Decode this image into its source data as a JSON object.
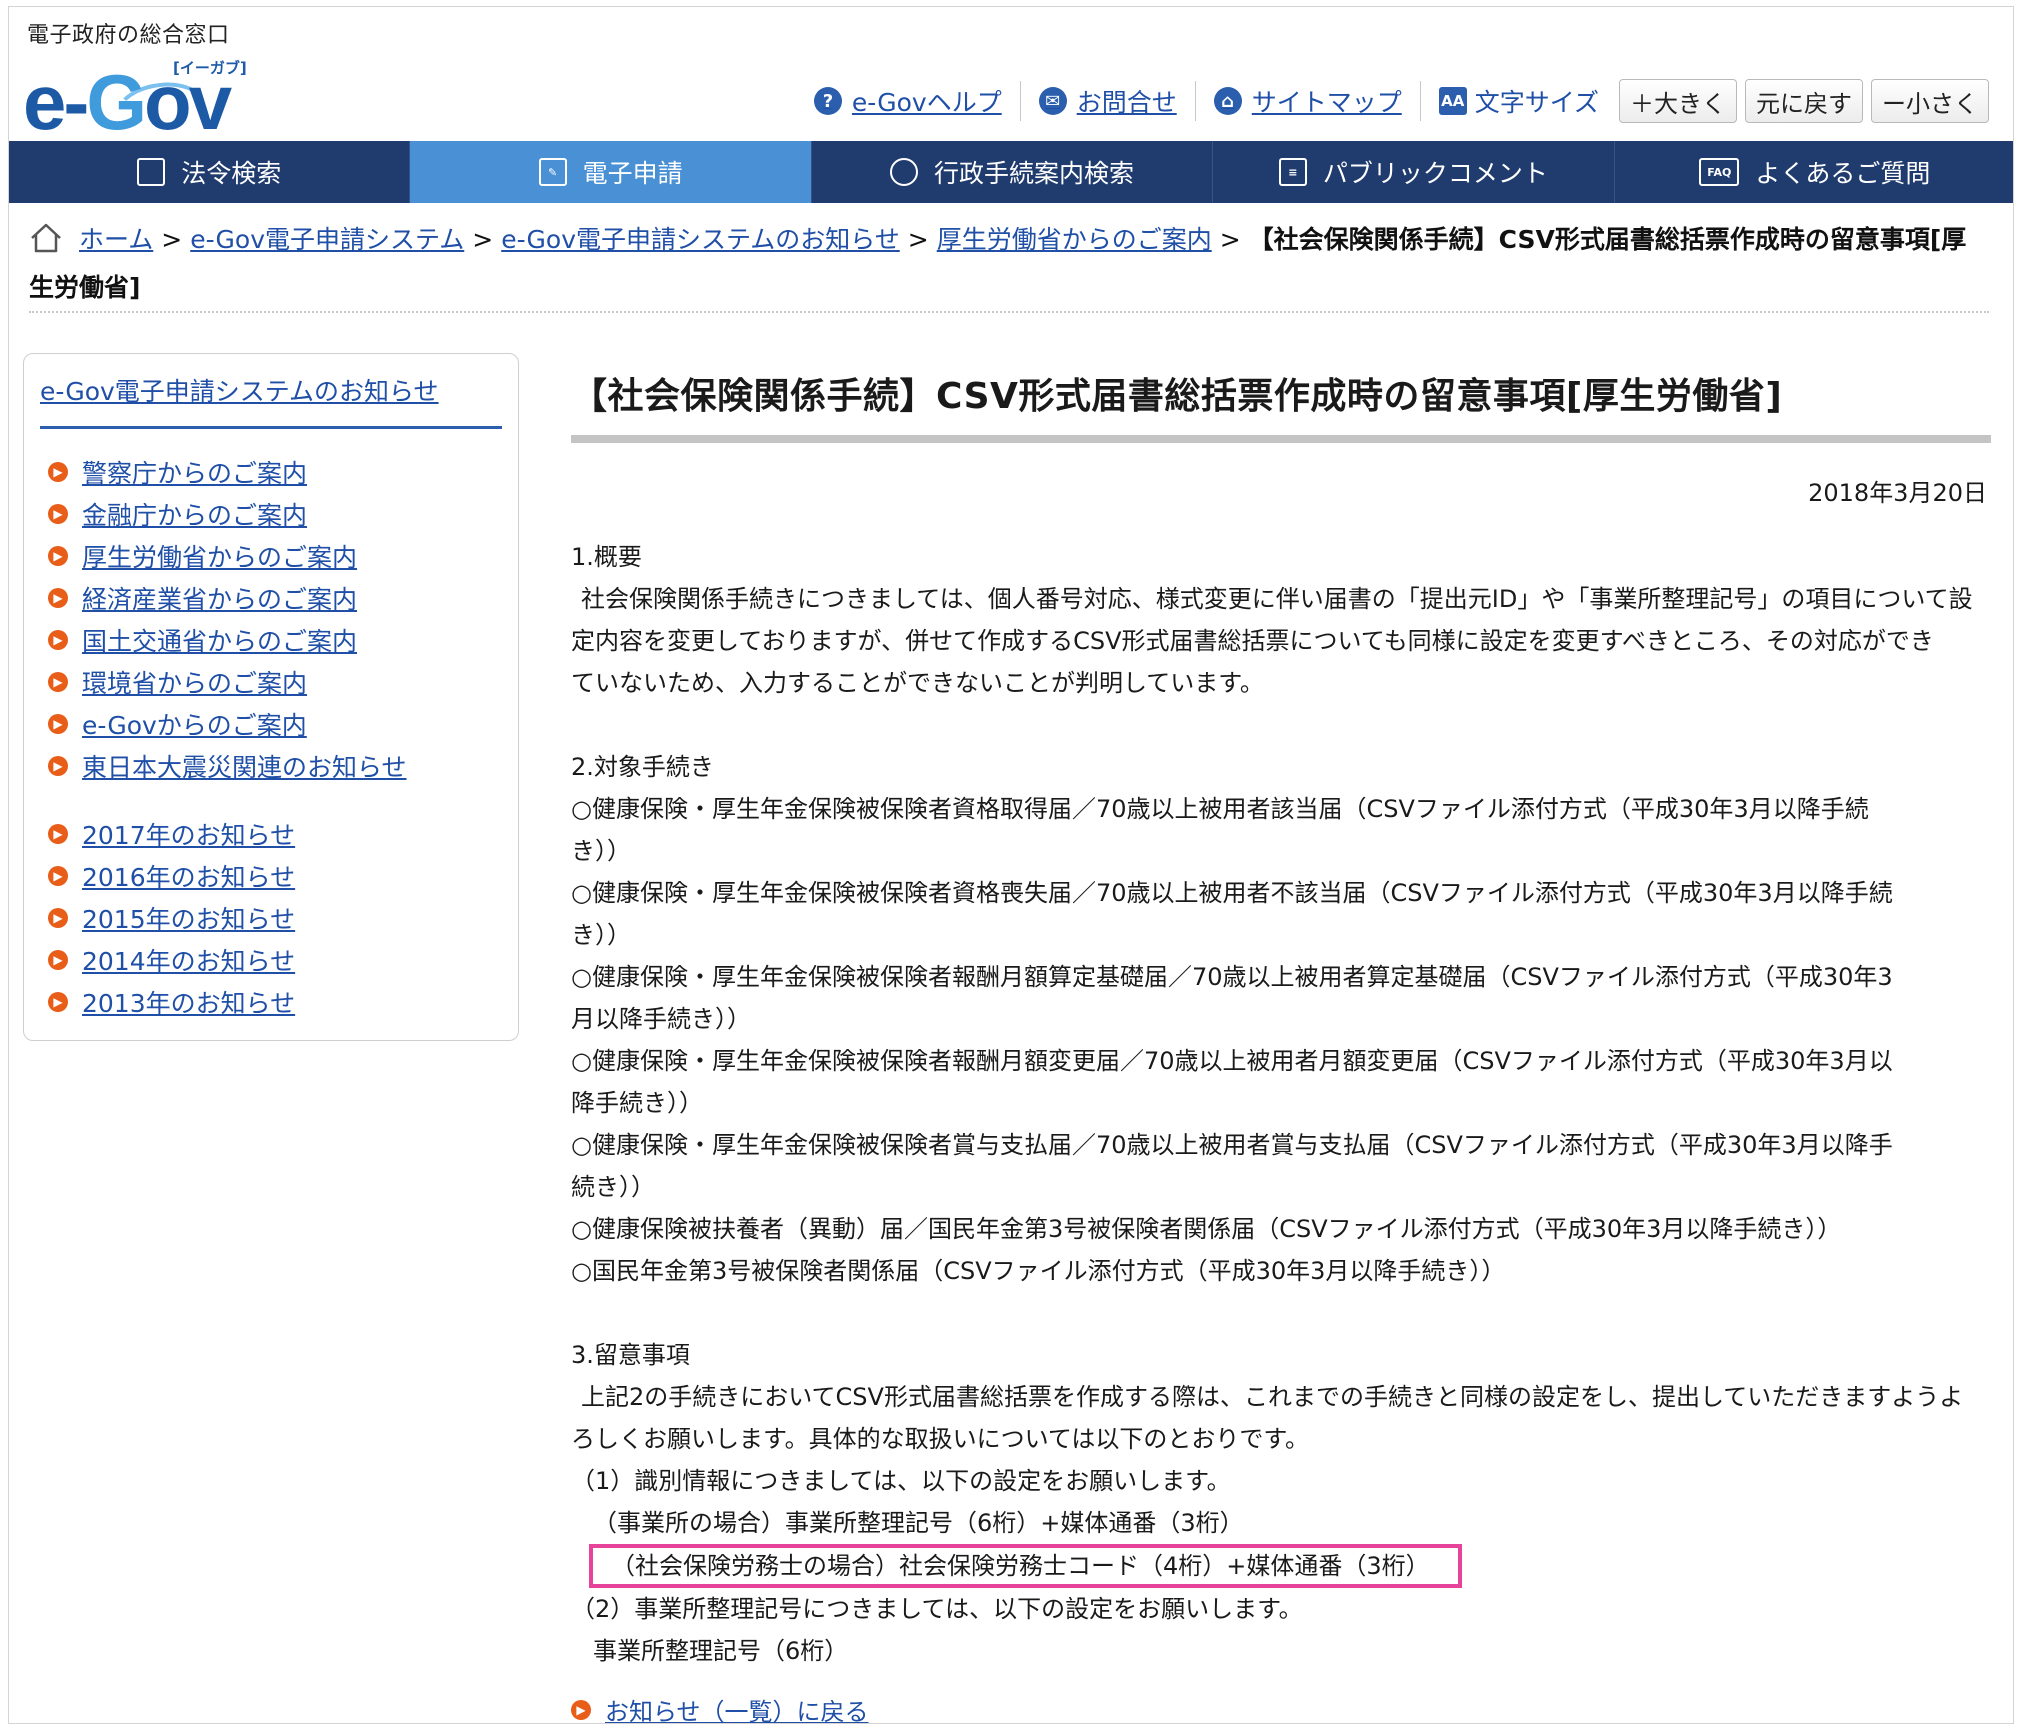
{
  "header": {
    "tagline": "電子政府の総合窓口",
    "logo_text": "e-Gov",
    "logo_reading": "[イーガブ]"
  },
  "utility": {
    "help": "e-Govヘルプ",
    "contact": "お問合せ",
    "sitemap": "サイトマップ",
    "font_size_label": "文字サイズ",
    "font_larger": "＋大きく",
    "font_reset": "元に戻す",
    "font_smaller": "ー小さく"
  },
  "nav": {
    "tabs": [
      {
        "label": "法令検索",
        "icon": "book-icon"
      },
      {
        "label": "電子申請",
        "icon": "edit-icon",
        "active": true
      },
      {
        "label": "行政手続案内検索",
        "icon": "search-icon"
      },
      {
        "label": "パブリックコメント",
        "icon": "comment-icon"
      },
      {
        "label": "よくあるご質問",
        "icon": "faq-icon"
      }
    ]
  },
  "breadcrumb": {
    "items": [
      "ホーム",
      "e-Gov電子申請システム",
      "e-Gov電子申請システムのお知らせ",
      "厚生労働省からのご案内"
    ],
    "separator": ">",
    "current": "【社会保険関係手続】CSV形式届書総括票作成時の留意事項[厚生労働省]"
  },
  "sidebar": {
    "title": "e-Gov電子申請システムのお知らせ",
    "ministries": [
      "警察庁からのご案内",
      "金融庁からのご案内",
      "厚生労働省からのご案内",
      "経済産業省からのご案内",
      "国土交通省からのご案内",
      "環境省からのご案内",
      "e-Govからのご案内",
      "東日本大震災関連のお知らせ"
    ],
    "years": [
      "2017年のお知らせ",
      "2016年のお知らせ",
      "2015年のお知らせ",
      "2014年のお知らせ",
      "2013年のお知らせ"
    ]
  },
  "article": {
    "title": "【社会保険関係手続】CSV形式届書総括票作成時の留意事項[厚生労働省]",
    "date": "2018年3月20日",
    "s1_heading": "1.概要",
    "s1_body_1": "社会保険関係手続きにつきましては、個人番号対応、様式変更に伴い届書の「提出元ID」や「事業所整理記号」の項目について設",
    "s1_body_2": "定内容を変更しておりますが、併せて作成するCSV形式届書総括票についても同様に設定を変更すべきところ、その対応ができ",
    "s1_body_3": "ていないため、入力することができないことが判明しています。",
    "s2_heading": "2.対象手続き",
    "s2_i1a": "○健康保険・厚生年金保険被保険者資格取得届／70歳以上被用者該当届（CSVファイル添付方式（平成30年3月以降手続",
    "s2_i1b": "き））",
    "s2_i2a": "○健康保険・厚生年金保険被保険者資格喪失届／70歳以上被用者不該当届（CSVファイル添付方式（平成30年3月以降手続",
    "s2_i2b": "き））",
    "s2_i3a": "○健康保険・厚生年金保険被保険者報酬月額算定基礎届／70歳以上被用者算定基礎届（CSVファイル添付方式（平成30年3",
    "s2_i3b": "月以降手続き））",
    "s2_i4a": "○健康保険・厚生年金保険被保険者報酬月額変更届／70歳以上被用者月額変更届（CSVファイル添付方式（平成30年3月以",
    "s2_i4b": "降手続き））",
    "s2_i5a": "○健康保険・厚生年金保険被保険者賞与支払届／70歳以上被用者賞与支払届（CSVファイル添付方式（平成30年3月以降手",
    "s2_i5b": "続き））",
    "s2_i6": "○健康保険被扶養者（異動）届／国民年金第3号被保険者関係届（CSVファイル添付方式（平成30年3月以降手続き））",
    "s2_i7": "○国民年金第3号被保険者関係届（CSVファイル添付方式（平成30年3月以降手続き））",
    "s3_heading": "3.留意事項",
    "s3_body_1": "上記2の手続きにおいてCSV形式届書総括票を作成する際は、これまでの手続きと同様の設定をし、提出していただきますようよ",
    "s3_body_2": "ろしくお願いします。具体的な取扱いについては以下のとおりです。",
    "s3_p1": "（1）識別情報につきましては、以下の設定をお願いします。",
    "s3_p1_office": "（事業所の場合）事業所整理記号（6桁）+媒体通番（3桁）",
    "s3_p1_sharoushi": "（社会保険労務士の場合）社会保険労務士コード（4桁）+媒体通番（3桁）",
    "s3_p2": "（2）事業所整理記号につきましては、以下の設定をお願いします。",
    "s3_p2_value": "事業所整理記号（6桁）",
    "back_link": "お知らせ（一覧）に戻る"
  },
  "colors": {
    "nav_bg": "#203c6e",
    "nav_active": "#4a90d4",
    "link": "#1f4fa6",
    "arrow": "#e85d18",
    "highlight": "#e8439b"
  }
}
